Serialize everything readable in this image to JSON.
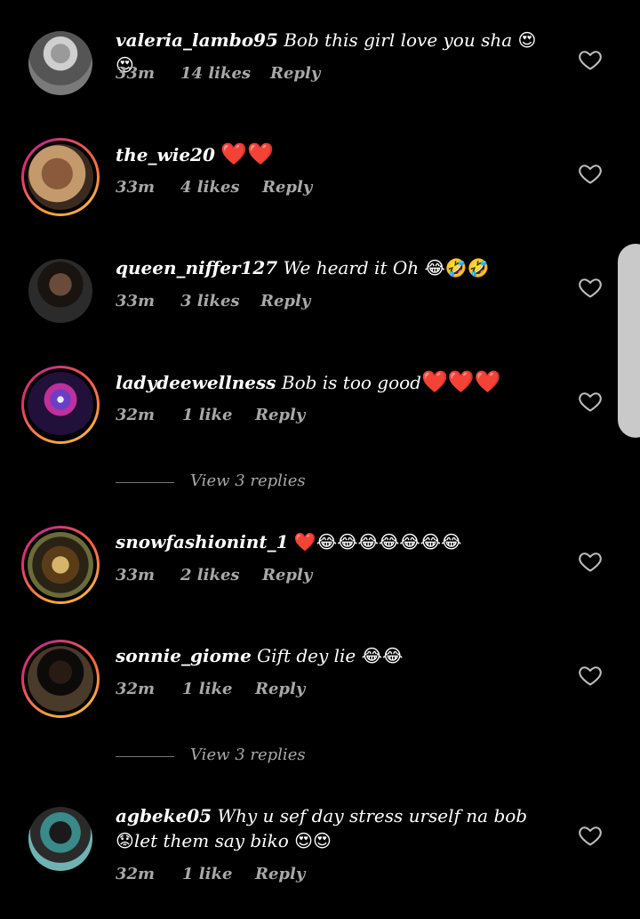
{
  "comments": [
    {
      "username": "valeria_lambo95",
      "text": "Bob this girl love you sha",
      "emoji": "😍😍",
      "time": "33m",
      "likes": "14 likes",
      "reply": "Reply"
    },
    {
      "username": "the_wie20",
      "text": "",
      "emoji": "❤️❤️",
      "time": "33m",
      "likes": "4 likes",
      "reply": "Reply"
    },
    {
      "username": "queen_niffer127",
      "text": "We heard it Oh",
      "emoji": "😂🤣🤣",
      "time": "33m",
      "likes": "3 likes",
      "reply": "Reply"
    },
    {
      "username": "ladydeewellness",
      "text": "Bob is too good",
      "emoji": "❤️❤️❤️",
      "time": "32m",
      "likes": "1 like",
      "reply": "Reply",
      "view_replies": "View 3 replies"
    },
    {
      "username": "snowfashionint_1",
      "text": "",
      "emoji": "❤️😂😂😂😂😂😂😂",
      "time": "33m",
      "likes": "2 likes",
      "reply": "Reply"
    },
    {
      "username": "sonnie_giome",
      "text": "Gift dey lie",
      "emoji": "😂😂",
      "time": "32m",
      "likes": "1 like",
      "reply": "Reply",
      "view_replies": "View 3 replies"
    },
    {
      "username": "agbeke05",
      "text": "Why u sef day stress urself na bob",
      "emoji": "😟",
      "text2": "let them say biko",
      "emoji2": "😍😍",
      "time": "32m",
      "likes": "1 like",
      "reply": "Reply"
    }
  ],
  "icons": {
    "like": "heart-outline-icon"
  },
  "colors": {
    "background": "#000000",
    "meta_text": "#a8a8a8",
    "heart": "#e0201c"
  }
}
